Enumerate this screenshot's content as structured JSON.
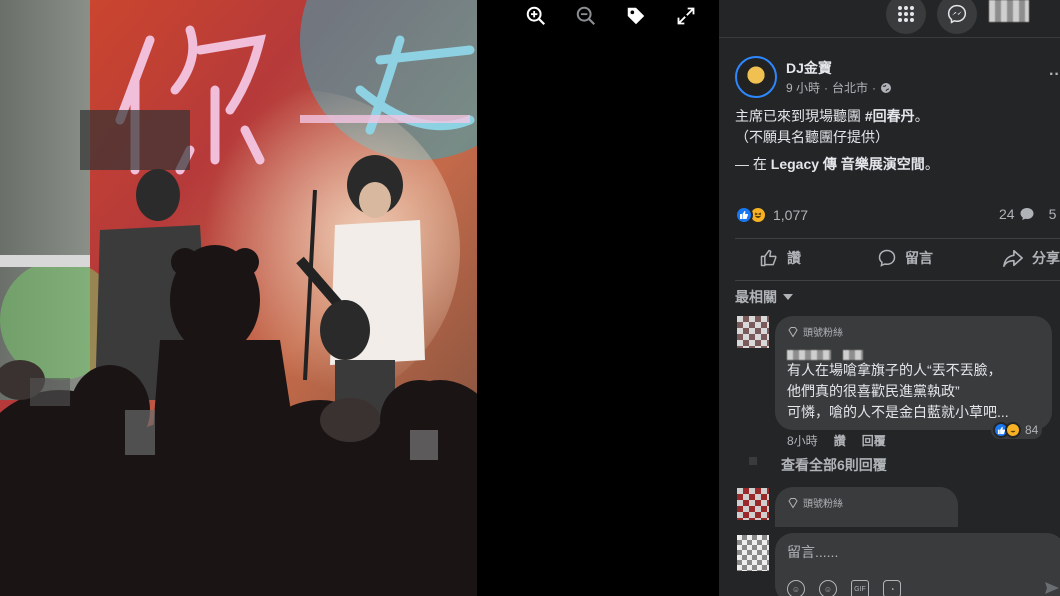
{
  "viewer": {
    "toolbar": [
      {
        "name": "zoom-in-icon"
      },
      {
        "name": "zoom-out-icon"
      },
      {
        "name": "tag-icon"
      },
      {
        "name": "fullscreen-icon"
      }
    ],
    "photo_caption_chars": "你 女"
  },
  "topbar": {
    "buttons": [
      {
        "name": "menu-grid-icon"
      },
      {
        "name": "messenger-icon"
      }
    ]
  },
  "post": {
    "author": "DJ金寶",
    "time": "9 小時",
    "location": "台北市",
    "privacy_icon": "globe-icon",
    "text_line1_prefix": "主席已來到現場聽團 ",
    "text_line1_tag": "#回春丹",
    "text_line1_suffix": "。",
    "text_line2": "（不願具名聽團仔提供）",
    "text_line3_prefix": "— 在 ",
    "text_line3_place": "Legacy 傳 音樂展演空間",
    "text_line3_suffix": "。",
    "reaction_count": "1,077",
    "comment_count": "24",
    "share_count": "5",
    "actions": {
      "like": "讚",
      "comment": "留言",
      "share": "分享"
    },
    "sort_label": "最相關"
  },
  "comments": [
    {
      "badge": "頭號粉絲",
      "lines": [
        "有人在場嗆拿旗子的人“丟不丟臉，",
        "他們真的很喜歡民進黨執政”",
        "可憐，嗆的人不是金白藍就小草吧..."
      ],
      "time": "8小時",
      "like": "讚",
      "reply": "回覆",
      "reactions": "84"
    },
    {
      "badge": "頭號粉絲"
    }
  ],
  "view_all_replies": "查看全部6則回覆",
  "composer": {
    "placeholder": "留言......"
  },
  "colors": {
    "panel_bg": "#242526",
    "bubble_bg": "#3a3b3c",
    "accent_blue": "#2d88ff",
    "text_primary": "#e4e6eb",
    "text_secondary": "#b0b3b8"
  }
}
